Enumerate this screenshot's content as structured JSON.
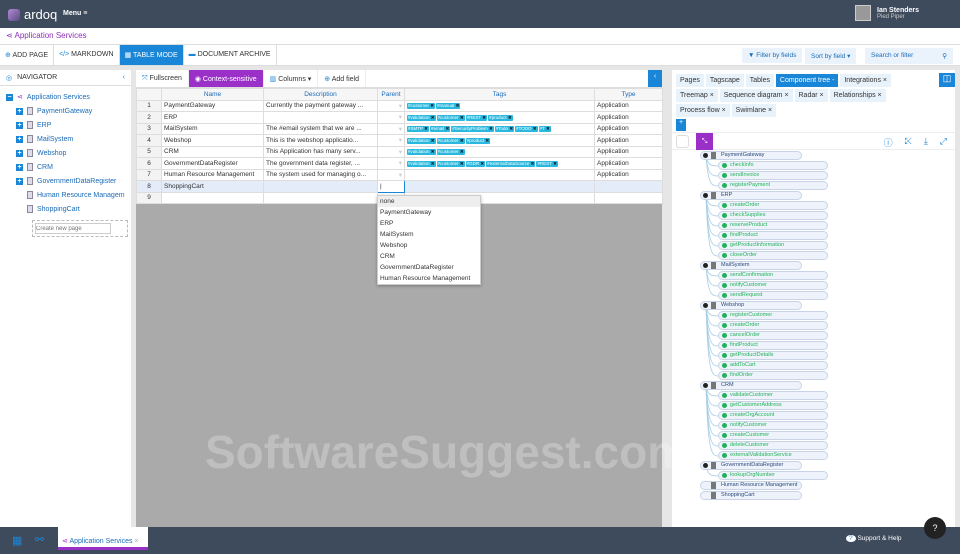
{
  "app": {
    "logo": "ardoq",
    "menu": "Menu ≡",
    "user_name": "Ian Stenders",
    "org": "Pied Piper"
  },
  "title": "Application Services",
  "toolbar": {
    "add_page": "ADD PAGE",
    "markdown": "MARKDOWN",
    "table_mode": "TABLE MODE",
    "document_archive": "DOCUMENT ARCHIVE",
    "filter": "Filter by fields",
    "sort": "Sort by field ▾",
    "search_placeholder": "Search or filter"
  },
  "navigator": {
    "title": "NAVIGATOR",
    "root": "Application Services",
    "items": [
      {
        "label": "PaymentGateway",
        "exp": true
      },
      {
        "label": "ERP",
        "exp": true
      },
      {
        "label": "MailSystem",
        "exp": true
      },
      {
        "label": "Webshop",
        "exp": true
      },
      {
        "label": "CRM",
        "exp": true
      },
      {
        "label": "GovernmentDataRegister",
        "exp": true
      },
      {
        "label": "Human Resource Managem",
        "exp": false
      },
      {
        "label": "ShoppingCart",
        "exp": false
      }
    ],
    "new_page_placeholder": "Create new page"
  },
  "table_toolbar": {
    "fullscreen": "Fullscreen",
    "context": "Context-sensitive",
    "columns": "Columns ▾",
    "add_field": "Add field"
  },
  "table": {
    "headers": [
      "",
      "Name",
      "Description",
      "Parent",
      "Tags",
      "Type"
    ],
    "rows": [
      {
        "n": "1",
        "name": "PaymentGateway",
        "desc": "Currently the payment gateway ...",
        "tags": [
          "#customer",
          "#manual"
        ],
        "type": "Application"
      },
      {
        "n": "2",
        "name": "ERP",
        "desc": "",
        "tags": [
          "#validation",
          "#customer",
          "#REST",
          "#product"
        ],
        "type": "Application"
      },
      {
        "n": "3",
        "name": "MailSystem",
        "desc": "The #email system that we are ...",
        "tags": [
          "#SMTP",
          "#email",
          "#SecurityProblem",
          "#Todo",
          "#TODO",
          "#T"
        ],
        "type": "Application"
      },
      {
        "n": "4",
        "name": "Webshop",
        "desc": "This is the webshop applicatio...",
        "tags": [
          "#validation",
          "#customer",
          "#product"
        ],
        "type": "Application"
      },
      {
        "n": "5",
        "name": "CRM",
        "desc": "This Application has many serv...",
        "tags": [
          "#validation",
          "#customer"
        ],
        "type": "Application"
      },
      {
        "n": "6",
        "name": "GovernmentDataRegister",
        "desc": "The government data register, ...",
        "tags": [
          "#validation",
          "#customer",
          "#GDR",
          "#externalDataSource",
          "#REST"
        ],
        "type": "Application"
      },
      {
        "n": "7",
        "name": "Human Resource Management",
        "desc": "The system used for managing o...",
        "tags": [],
        "type": "Application"
      },
      {
        "n": "8",
        "name": "ShoppingCart",
        "desc": "",
        "tags": [],
        "type": ""
      },
      {
        "n": "9",
        "name": "",
        "desc": "",
        "tags": [],
        "type": ""
      }
    ]
  },
  "parent_dropdown": [
    "none",
    "PaymentGateway",
    "ERP",
    "MailSystem",
    "Webshop",
    "CRM",
    "GovernmentDataRegister",
    "Human Resource Management"
  ],
  "watermark": "SoftwareSuggest.com",
  "right_tabs": [
    {
      "label": "Pages"
    },
    {
      "label": "Tagscape"
    },
    {
      "label": "Tables"
    },
    {
      "label": "Component tree -",
      "active": true
    },
    {
      "label": "Integrations ×"
    },
    {
      "label": "Treemap ×"
    },
    {
      "label": "Sequence diagram ×"
    },
    {
      "label": "Radar ×"
    },
    {
      "label": "Relationships ×"
    },
    {
      "label": "Process flow ×"
    },
    {
      "label": "Swimlane ×"
    }
  ],
  "tree": [
    {
      "name": "PaymentGateway",
      "children": [
        "checkInfo",
        "sendInvoice",
        "registerPayment"
      ]
    },
    {
      "name": "ERP",
      "children": [
        "createOrder",
        "checkSupplies",
        "reserveProduct",
        "findProduct",
        "getProductInformation",
        "closeOrder"
      ]
    },
    {
      "name": "MailSystem",
      "children": [
        "sendConfirmation",
        "notifyCustomer",
        "sendRequest"
      ]
    },
    {
      "name": "Webshop",
      "children": [
        "registerCustomer",
        "createOrder",
        "cancelOrder",
        "findProduct",
        "getProductDetails",
        "addToCart",
        "findOrder"
      ]
    },
    {
      "name": "CRM",
      "children": [
        "validateCustomer",
        "getCustomerAddress",
        "createOrgAccount",
        "notifyCustomer",
        "createCustomer",
        "deleteCustomer",
        "externalValidationService"
      ]
    },
    {
      "name": "GovernmentDataRegister",
      "children": [
        "lookupOrgNumber"
      ]
    },
    {
      "name": "Human Resource Management",
      "children": []
    },
    {
      "name": "ShoppingCart",
      "children": []
    }
  ],
  "bottom": {
    "tab": "Application Services",
    "support": "Support & Help"
  }
}
